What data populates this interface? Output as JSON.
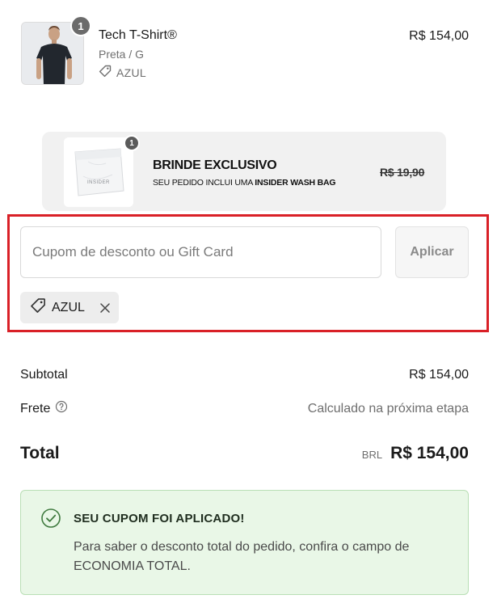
{
  "product": {
    "name": "Tech T-Shirt®",
    "variant": "Preta / G",
    "discount_code": "AZUL",
    "price": "R$ 154,00",
    "quantity": "1",
    "icon": "tag-icon"
  },
  "gift": {
    "badge": "1",
    "title": "BRINDE EXCLUSIVO",
    "subtitle_prefix": "SEU PEDIDO INCLUI UMA",
    "subtitle_bold": "INSIDER WASH BAG",
    "old_price": "R$ 19,90",
    "bag_logo": "INSIDER"
  },
  "coupon": {
    "placeholder": "Cupom de desconto ou Gift Card",
    "value": "",
    "apply_label": "Aplicar",
    "applied_tag": "AZUL",
    "highlight_color": "#d92027"
  },
  "summary": {
    "subtotal_label": "Subtotal",
    "subtotal_value": "R$ 154,00",
    "shipping_label": "Frete",
    "shipping_value": "Calculado na próxima etapa",
    "total_label": "Total",
    "currency": "BRL",
    "total_value": "R$ 154,00"
  },
  "notice": {
    "title": "SEU CUPOM FOI APLICADO!",
    "text": "Para saber o desconto total do pedido, confira o campo de ECONOMIA TOTAL.",
    "bg_color": "#e9f7e7",
    "icon": "check-circle-icon"
  }
}
